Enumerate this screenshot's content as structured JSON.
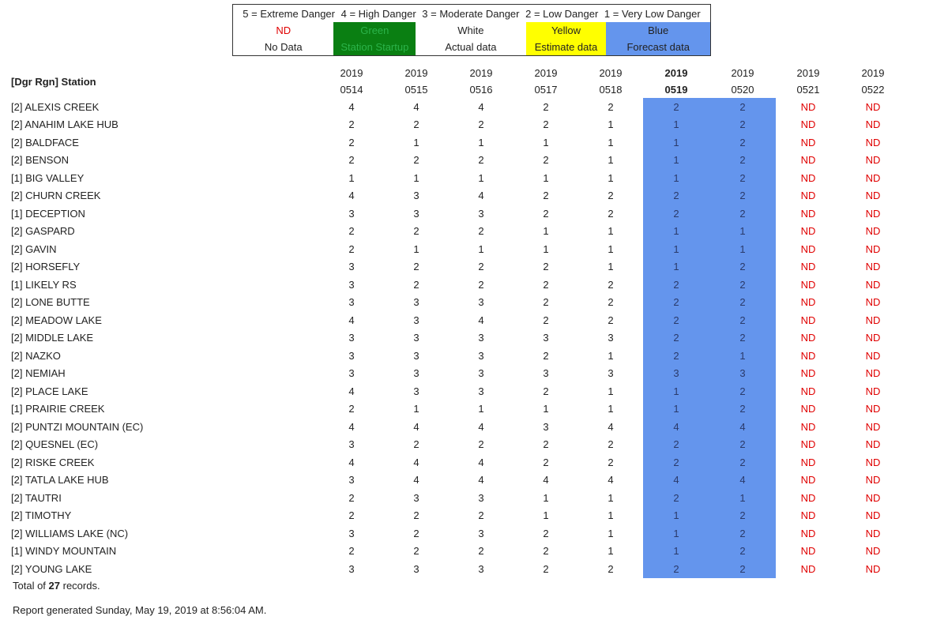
{
  "legend": {
    "scale": [
      "5 = Extreme Danger",
      "4 = High Danger",
      "3 = Moderate Danger",
      "2 = Low Danger",
      "1 = Very Low Danger"
    ],
    "items": [
      {
        "swatch": "ND",
        "desc": "No Data"
      },
      {
        "swatch": "Green",
        "desc": "Station Startup"
      },
      {
        "swatch": "White",
        "desc": "Actual data"
      },
      {
        "swatch": "Yellow",
        "desc": "Estimate data"
      },
      {
        "swatch": "Blue",
        "desc": "Forecast data"
      }
    ],
    "colors": {
      "nd": "#e00000",
      "green": "#0a7f12",
      "yellow": "#ffff00",
      "blue": "#6495ed"
    }
  },
  "table": {
    "station_header": "[Dgr Rgn] Station",
    "years": [
      "2019",
      "2019",
      "2019",
      "2019",
      "2019",
      "2019",
      "2019",
      "2019",
      "2019"
    ],
    "dates": [
      "0514",
      "0515",
      "0516",
      "0517",
      "0518",
      "0519",
      "0520",
      "0521",
      "0522"
    ],
    "rows": [
      {
        "station": "[2] ALEXIS CREEK",
        "values": [
          "4",
          "4",
          "4",
          "2",
          "2",
          "2",
          "2",
          "ND",
          "ND"
        ]
      },
      {
        "station": "[2] ANAHIM LAKE HUB",
        "values": [
          "2",
          "2",
          "2",
          "2",
          "1",
          "1",
          "2",
          "ND",
          "ND"
        ]
      },
      {
        "station": "[2] BALDFACE",
        "values": [
          "2",
          "1",
          "1",
          "1",
          "1",
          "1",
          "2",
          "ND",
          "ND"
        ]
      },
      {
        "station": "[2] BENSON",
        "values": [
          "2",
          "2",
          "2",
          "2",
          "1",
          "1",
          "2",
          "ND",
          "ND"
        ]
      },
      {
        "station": "[1] BIG VALLEY",
        "values": [
          "1",
          "1",
          "1",
          "1",
          "1",
          "1",
          "2",
          "ND",
          "ND"
        ]
      },
      {
        "station": "[2] CHURN CREEK",
        "values": [
          "4",
          "3",
          "4",
          "2",
          "2",
          "2",
          "2",
          "ND",
          "ND"
        ]
      },
      {
        "station": "[1] DECEPTION",
        "values": [
          "3",
          "3",
          "3",
          "2",
          "2",
          "2",
          "2",
          "ND",
          "ND"
        ]
      },
      {
        "station": "[2] GASPARD",
        "values": [
          "2",
          "2",
          "2",
          "1",
          "1",
          "1",
          "1",
          "ND",
          "ND"
        ]
      },
      {
        "station": "[2] GAVIN",
        "values": [
          "2",
          "1",
          "1",
          "1",
          "1",
          "1",
          "1",
          "ND",
          "ND"
        ]
      },
      {
        "station": "[2] HORSEFLY",
        "values": [
          "3",
          "2",
          "2",
          "2",
          "1",
          "1",
          "2",
          "ND",
          "ND"
        ]
      },
      {
        "station": "[1] LIKELY RS",
        "values": [
          "3",
          "2",
          "2",
          "2",
          "2",
          "2",
          "2",
          "ND",
          "ND"
        ]
      },
      {
        "station": "[2] LONE BUTTE",
        "values": [
          "3",
          "3",
          "3",
          "2",
          "2",
          "2",
          "2",
          "ND",
          "ND"
        ]
      },
      {
        "station": "[2] MEADOW LAKE",
        "values": [
          "4",
          "3",
          "4",
          "2",
          "2",
          "2",
          "2",
          "ND",
          "ND"
        ]
      },
      {
        "station": "[2] MIDDLE LAKE",
        "values": [
          "3",
          "3",
          "3",
          "3",
          "3",
          "2",
          "2",
          "ND",
          "ND"
        ]
      },
      {
        "station": "[2] NAZKO",
        "values": [
          "3",
          "3",
          "3",
          "2",
          "1",
          "2",
          "1",
          "ND",
          "ND"
        ]
      },
      {
        "station": "[2] NEMIAH",
        "values": [
          "3",
          "3",
          "3",
          "3",
          "3",
          "3",
          "3",
          "ND",
          "ND"
        ]
      },
      {
        "station": "[2] PLACE LAKE",
        "values": [
          "4",
          "3",
          "3",
          "2",
          "1",
          "1",
          "2",
          "ND",
          "ND"
        ]
      },
      {
        "station": "[1] PRAIRIE CREEK",
        "values": [
          "2",
          "1",
          "1",
          "1",
          "1",
          "1",
          "2",
          "ND",
          "ND"
        ]
      },
      {
        "station": "[2] PUNTZI MOUNTAIN (EC)",
        "values": [
          "4",
          "4",
          "4",
          "3",
          "4",
          "4",
          "4",
          "ND",
          "ND"
        ]
      },
      {
        "station": "[2] QUESNEL (EC)",
        "values": [
          "3",
          "2",
          "2",
          "2",
          "2",
          "2",
          "2",
          "ND",
          "ND"
        ]
      },
      {
        "station": "[2] RISKE CREEK",
        "values": [
          "4",
          "4",
          "4",
          "2",
          "2",
          "2",
          "2",
          "ND",
          "ND"
        ]
      },
      {
        "station": "[2] TATLA LAKE HUB",
        "values": [
          "3",
          "4",
          "4",
          "4",
          "4",
          "4",
          "4",
          "ND",
          "ND"
        ]
      },
      {
        "station": "[2] TAUTRI",
        "values": [
          "2",
          "3",
          "3",
          "1",
          "1",
          "2",
          "1",
          "ND",
          "ND"
        ]
      },
      {
        "station": "[2] TIMOTHY",
        "values": [
          "2",
          "2",
          "2",
          "1",
          "1",
          "1",
          "2",
          "ND",
          "ND"
        ]
      },
      {
        "station": "[2] WILLIAMS LAKE (NC)",
        "values": [
          "3",
          "2",
          "3",
          "2",
          "1",
          "1",
          "2",
          "ND",
          "ND"
        ]
      },
      {
        "station": "[1] WINDY MOUNTAIN",
        "values": [
          "2",
          "2",
          "2",
          "2",
          "1",
          "1",
          "2",
          "ND",
          "ND"
        ]
      },
      {
        "station": "[2] YOUNG LAKE",
        "values": [
          "3",
          "3",
          "3",
          "2",
          "2",
          "2",
          "2",
          "ND",
          "ND"
        ]
      }
    ]
  },
  "footer": {
    "total_prefix": "Total of ",
    "total_count": "27",
    "total_suffix": " records.",
    "generated": "Report generated Sunday, May 19, 2019 at 8:56:04 AM."
  }
}
